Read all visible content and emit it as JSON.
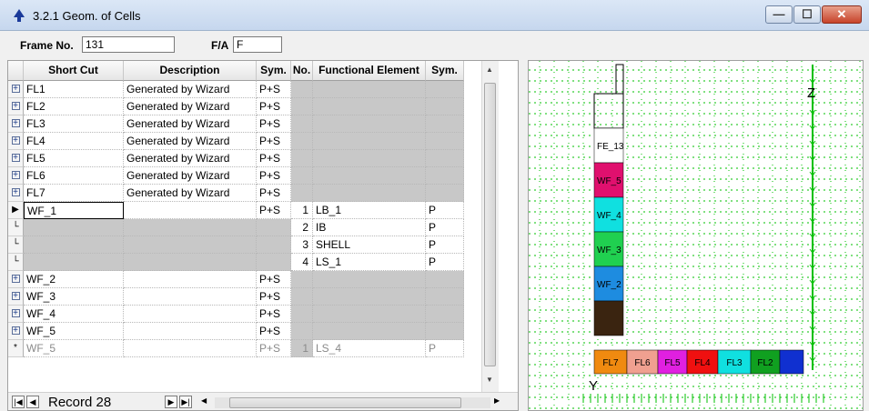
{
  "window": {
    "title": "3.2.1 Geom. of Cells",
    "min_label": "—",
    "max_label": "☐",
    "close_label": "✕"
  },
  "toolbar": {
    "frame_label": "Frame No.",
    "frame_value": "131",
    "fa_label": "F/A",
    "fa_value": "F"
  },
  "grid": {
    "headers": [
      "Short Cut",
      "Description",
      "Sym.",
      "No.",
      "Functional Element",
      "Sym."
    ],
    "rows": [
      {
        "sel": "+",
        "shortcut": "FL1",
        "desc": "Generated by Wizard",
        "sym": "P+S",
        "no": "",
        "fe": "",
        "sym2": ""
      },
      {
        "sel": "+",
        "shortcut": "FL2",
        "desc": "Generated by Wizard",
        "sym": "P+S",
        "no": "",
        "fe": "",
        "sym2": ""
      },
      {
        "sel": "+",
        "shortcut": "FL3",
        "desc": "Generated by Wizard",
        "sym": "P+S",
        "no": "",
        "fe": "",
        "sym2": ""
      },
      {
        "sel": "+",
        "shortcut": "FL4",
        "desc": "Generated by Wizard",
        "sym": "P+S",
        "no": "",
        "fe": "",
        "sym2": ""
      },
      {
        "sel": "+",
        "shortcut": "FL5",
        "desc": "Generated by Wizard",
        "sym": "P+S",
        "no": "",
        "fe": "",
        "sym2": ""
      },
      {
        "sel": "+",
        "shortcut": "FL6",
        "desc": "Generated by Wizard",
        "sym": "P+S",
        "no": "",
        "fe": "",
        "sym2": ""
      },
      {
        "sel": "+",
        "shortcut": "FL7",
        "desc": "Generated by Wizard",
        "sym": "P+S",
        "no": "",
        "fe": "",
        "sym2": ""
      },
      {
        "sel": "▶",
        "shortcut": "WF_1",
        "desc": "",
        "sym": "P+S",
        "no": "1",
        "fe": "LB_1",
        "sym2": "P"
      },
      {
        "sel": "└",
        "shortcut": "",
        "desc": "",
        "sym": "",
        "no": "2",
        "fe": "IB",
        "sym2": "P"
      },
      {
        "sel": "└",
        "shortcut": "",
        "desc": "",
        "sym": "",
        "no": "3",
        "fe": "SHELL",
        "sym2": "P"
      },
      {
        "sel": "└",
        "shortcut": "",
        "desc": "",
        "sym": "",
        "no": "4",
        "fe": "LS_1",
        "sym2": "P"
      },
      {
        "sel": "+",
        "shortcut": "WF_2",
        "desc": "",
        "sym": "P+S",
        "no": "",
        "fe": "",
        "sym2": ""
      },
      {
        "sel": "+",
        "shortcut": "WF_3",
        "desc": "",
        "sym": "P+S",
        "no": "",
        "fe": "",
        "sym2": ""
      },
      {
        "sel": "+",
        "shortcut": "WF_4",
        "desc": "",
        "sym": "P+S",
        "no": "",
        "fe": "",
        "sym2": ""
      },
      {
        "sel": "+",
        "shortcut": "WF_5",
        "desc": "",
        "sym": "P+S",
        "no": "",
        "fe": "",
        "sym2": ""
      },
      {
        "sel": "*",
        "shortcut": "WF_5",
        "desc": "",
        "sym": "P+S",
        "no": "1",
        "fe": "LS_4",
        "sym2": "P"
      }
    ]
  },
  "nav": {
    "record_label": "Record",
    "record_value": "28"
  },
  "drawing": {
    "z_label": "Z",
    "y_label": "Y",
    "wall_cells": [
      {
        "label": "FE_13",
        "color": "#ffffff"
      },
      {
        "label": "WF_5",
        "color": "#e0106e"
      },
      {
        "label": "WF_4",
        "color": "#10e0e0"
      },
      {
        "label": "WF_3",
        "color": "#20d050"
      },
      {
        "label": "WF_2",
        "color": "#1e8ce0"
      },
      {
        "label": "",
        "color": "#3a2410"
      }
    ],
    "floor_cells": [
      {
        "label": "FL7",
        "color": "#f08a10"
      },
      {
        "label": "FL6",
        "color": "#f0a090"
      },
      {
        "label": "FL5",
        "color": "#e020e0"
      },
      {
        "label": "FL4",
        "color": "#f01010"
      },
      {
        "label": "FL3",
        "color": "#10e0e0"
      },
      {
        "label": "FL2",
        "color": "#10a020"
      },
      {
        "label": "",
        "color": "#1030d0"
      }
    ],
    "grid_color": "#00c000"
  }
}
